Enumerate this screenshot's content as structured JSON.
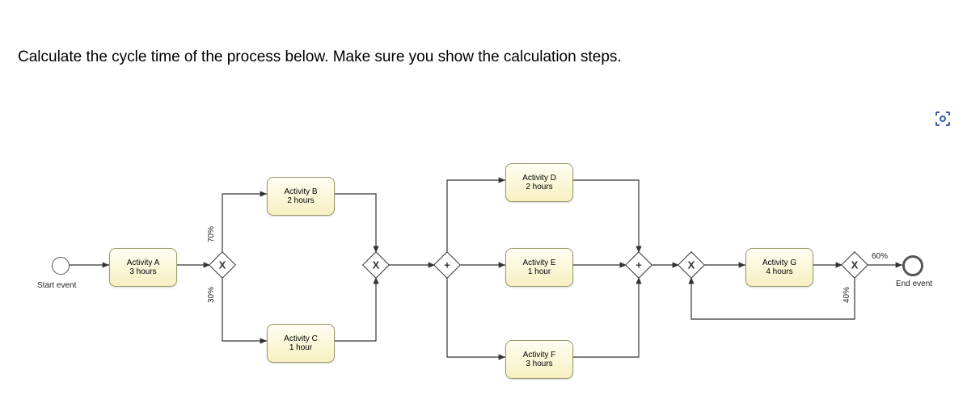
{
  "question": "Calculate the cycle time of the process below. Make sure you show the calculation steps.",
  "start_label": "Start event",
  "end_label": "End event",
  "activities": {
    "a": "Activity A\n3 hours",
    "b": "Activity B\n2 hours",
    "c": "Activity C\n1 hour",
    "d": "Activity D\n2 hours",
    "e": "Activity E\n1 hour",
    "f": "Activity F\n3 hours",
    "g": "Activity G\n4 hours"
  },
  "branch_labels": {
    "g1_top": "70%",
    "g1_bot": "30%",
    "g4_top": "60%",
    "g4_bot": "40%"
  },
  "gateway_marks": {
    "x": "X",
    "plus": "+"
  },
  "chart_data": {
    "type": "bpmn-process",
    "start": "start",
    "end": "end",
    "activities": [
      {
        "id": "A",
        "name": "Activity A",
        "duration_hours": 3
      },
      {
        "id": "B",
        "name": "Activity B",
        "duration_hours": 2
      },
      {
        "id": "C",
        "name": "Activity C",
        "duration_hours": 1
      },
      {
        "id": "D",
        "name": "Activity D",
        "duration_hours": 2
      },
      {
        "id": "E",
        "name": "Activity E",
        "duration_hours": 1
      },
      {
        "id": "F",
        "name": "Activity F",
        "duration_hours": 3
      },
      {
        "id": "G",
        "name": "Activity G",
        "duration_hours": 4
      }
    ],
    "gateways": [
      {
        "id": "g1",
        "type": "exclusive",
        "mode": "split"
      },
      {
        "id": "g2",
        "type": "exclusive",
        "mode": "merge"
      },
      {
        "id": "p1",
        "type": "parallel",
        "mode": "split"
      },
      {
        "id": "p2",
        "type": "parallel",
        "mode": "merge"
      },
      {
        "id": "g3",
        "type": "exclusive",
        "mode": "merge"
      },
      {
        "id": "g4",
        "type": "exclusive",
        "mode": "split"
      }
    ],
    "flows": [
      {
        "from": "start",
        "to": "A"
      },
      {
        "from": "A",
        "to": "g1"
      },
      {
        "from": "g1",
        "to": "B",
        "probability": 0.7
      },
      {
        "from": "g1",
        "to": "C",
        "probability": 0.3
      },
      {
        "from": "B",
        "to": "g2"
      },
      {
        "from": "C",
        "to": "g2"
      },
      {
        "from": "g2",
        "to": "p1"
      },
      {
        "from": "p1",
        "to": "D"
      },
      {
        "from": "p1",
        "to": "E"
      },
      {
        "from": "p1",
        "to": "F"
      },
      {
        "from": "D",
        "to": "p2"
      },
      {
        "from": "E",
        "to": "p2"
      },
      {
        "from": "F",
        "to": "p2"
      },
      {
        "from": "p2",
        "to": "g3"
      },
      {
        "from": "g3",
        "to": "G"
      },
      {
        "from": "G",
        "to": "g4"
      },
      {
        "from": "g4",
        "to": "end",
        "probability": 0.6
      },
      {
        "from": "g4",
        "to": "g3",
        "probability": 0.4
      }
    ]
  }
}
